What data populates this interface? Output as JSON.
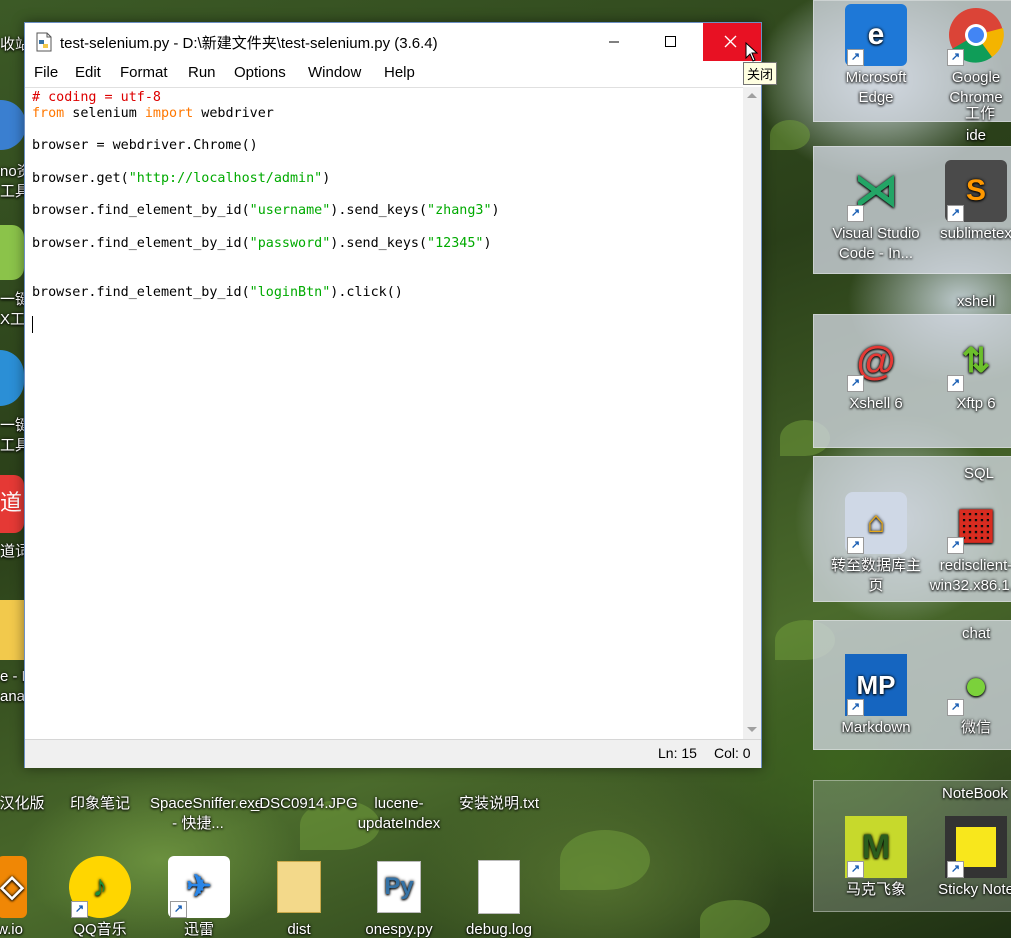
{
  "window": {
    "title": "test-selenium.py - D:\\新建文件夹\\test-selenium.py (3.6.4)",
    "close_tooltip": "关闭"
  },
  "menu": [
    "File",
    "Edit",
    "Format",
    "Run",
    "Options",
    "Window",
    "Help"
  ],
  "code": {
    "l1": "# coding = utf-8",
    "l2_kw1": "from",
    "l2_mid": " selenium ",
    "l2_kw2": "import",
    "l2_end": " webdriver",
    "l3": "browser = webdriver.Chrome()",
    "l4_a": "browser.get(",
    "l4_s": "\"http://localhost/admin\"",
    "l4_b": ")",
    "l5_a": "browser.find_element_by_id(",
    "l5_s1": "\"username\"",
    "l5_b": ").send_keys(",
    "l5_s2": "\"zhang3\"",
    "l5_c": ")",
    "l6_a": "browser.find_element_by_id(",
    "l6_s1": "\"password\"",
    "l6_b": ").send_keys(",
    "l6_s2": "\"12345\"",
    "l6_c": ")",
    "l7_a": "browser.find_element_by_id(",
    "l7_s": "\"loginBtn\"",
    "l7_b": ").click()"
  },
  "status": {
    "ln": "Ln: 15",
    "col": "Col: 0"
  },
  "desktop": {
    "right_icons": [
      {
        "label": "Microsoft Edge",
        "icon": "edge-icon"
      },
      {
        "label": "Google Chrome",
        "icon": "chrome-icon"
      },
      {
        "label": "Visual Studio Code - In...",
        "icon": "vscode-icon"
      },
      {
        "label": "sublimetex",
        "icon": "sublime-icon"
      },
      {
        "label": "Xshell 6",
        "icon": "xshell-icon"
      },
      {
        "label": "Xftp 6",
        "icon": "xftp-icon"
      },
      {
        "label": "转至数据库主页",
        "icon": "database-icon"
      },
      {
        "label": "redisclient-win32.x86.1...",
        "icon": "redis-icon"
      },
      {
        "label": "Markdown",
        "icon": "markdown-icon"
      },
      {
        "label": "微信",
        "icon": "wechat-icon"
      },
      {
        "label": "马克飞象",
        "icon": "maxiang-icon"
      },
      {
        "label": "Sticky Note",
        "icon": "sticky-note-icon"
      }
    ],
    "group_labels": [
      "工作",
      "ide",
      "xshell",
      "SQL",
      "chat",
      "NoteBook"
    ],
    "bottom_icons": [
      {
        "label": "汉化版"
      },
      {
        "label": "印象笔记"
      },
      {
        "label": "SpaceSniffer.exe - 快捷..."
      },
      {
        "label": "_DSC0914.JPG"
      },
      {
        "label": "lucene-updateIndex"
      },
      {
        "label": "安装说明.txt"
      }
    ],
    "bottom_row2": [
      {
        "label": "w.io"
      },
      {
        "label": "QQ音乐"
      },
      {
        "label": "迅雷"
      },
      {
        "label": "dist"
      },
      {
        "label": "onespy.py"
      },
      {
        "label": "debug.log"
      }
    ],
    "left_labels": [
      "收站",
      "no资",
      "工具",
      "一键",
      "X工",
      "一键",
      "工具",
      "道词",
      "e - E",
      "ana"
    ]
  }
}
